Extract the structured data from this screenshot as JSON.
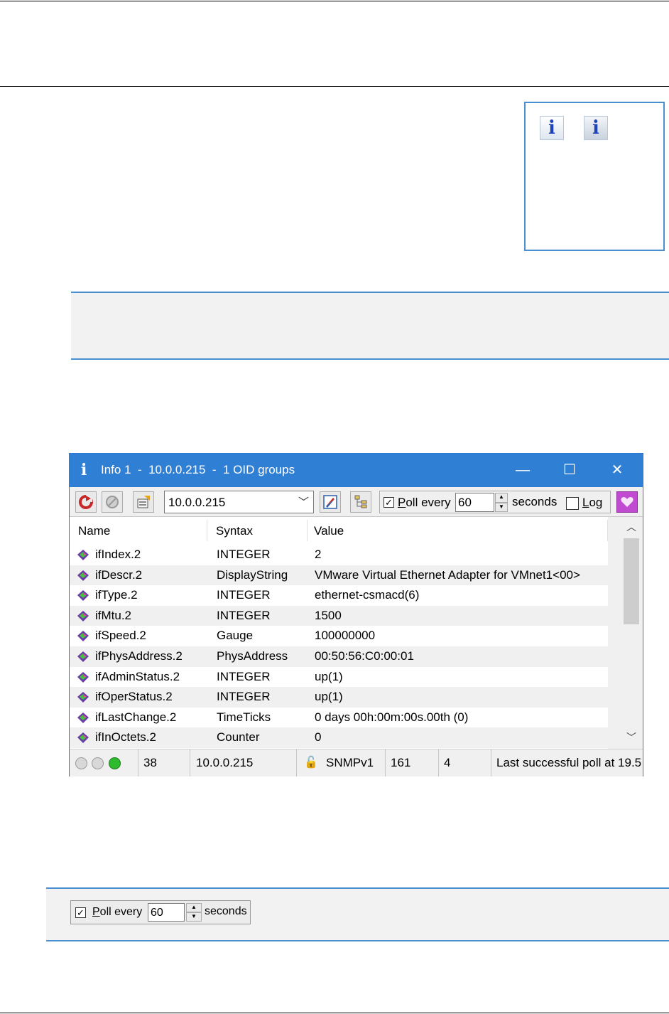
{
  "window": {
    "title": "Info 1  -  10.0.0.215  -  1 OID groups",
    "controls": {
      "minimize": "—",
      "maximize": "☐",
      "close": "✕"
    }
  },
  "toolbar": {
    "agent_address": "10.0.0.215",
    "poll_checked": true,
    "poll_label": "Poll every",
    "poll_interval": "60",
    "seconds_label": "seconds",
    "log_checked": false,
    "log_label": "Log"
  },
  "table": {
    "columns": [
      "Name",
      "Syntax",
      "Value"
    ],
    "rows": [
      {
        "name": "ifIndex.2",
        "syntax": "INTEGER",
        "value": "2"
      },
      {
        "name": "ifDescr.2",
        "syntax": "DisplayString",
        "value": "VMware Virtual Ethernet Adapter for VMnet1<00>"
      },
      {
        "name": "ifType.2",
        "syntax": "INTEGER",
        "value": "ethernet-csmacd(6)"
      },
      {
        "name": "ifMtu.2",
        "syntax": "INTEGER",
        "value": "1500"
      },
      {
        "name": "ifSpeed.2",
        "syntax": "Gauge",
        "value": "100000000"
      },
      {
        "name": "ifPhysAddress.2",
        "syntax": "PhysAddress",
        "value": "00:50:56:C0:00:01"
      },
      {
        "name": "ifAdminStatus.2",
        "syntax": "INTEGER",
        "value": "up(1)"
      },
      {
        "name": "ifOperStatus.2",
        "syntax": "INTEGER",
        "value": "up(1)"
      },
      {
        "name": "ifLastChange.2",
        "syntax": "TimeTicks",
        "value": "0 days 00h:00m:00s.00th (0)"
      },
      {
        "name": "ifInOctets.2",
        "syntax": "Counter",
        "value": "0"
      }
    ]
  },
  "status_bar": {
    "count": "38",
    "address": "10.0.0.215",
    "protocol": "SNMPv1",
    "port": "161",
    "retries": "4",
    "message": "Last successful poll at 19.5"
  },
  "poll_control_example": {
    "checked": true,
    "label": "Poll every",
    "interval": "60",
    "seconds_label": "seconds"
  },
  "colors": {
    "accent_blue": "#2f7fd5",
    "note_border": "#4a90d0",
    "status_green": "#2dbb2d"
  },
  "icons": [
    "info-icon",
    "info-icon-pressed",
    "refresh-icon",
    "stop-icon",
    "export-icon",
    "compass-icon",
    "tree-icon",
    "heart-icon",
    "oid-group-icon",
    "lock-icon"
  ]
}
